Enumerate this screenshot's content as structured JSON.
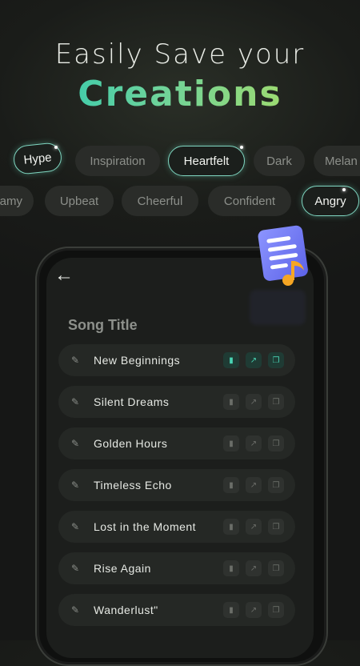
{
  "headline": {
    "line1": "Easily Save your",
    "line2": "Creations"
  },
  "moods": {
    "row1": [
      "Hype",
      "Inspiration",
      "Heartfelt",
      "Dark",
      "Melan"
    ],
    "row2": [
      "amy",
      "Upbeat",
      "Cheerful",
      "Confident",
      "Angry"
    ],
    "active": [
      "Hype",
      "Heartfelt",
      "Angry"
    ]
  },
  "phone": {
    "back_icon": "arrow-left-icon",
    "section_title": "Song Title",
    "songs": [
      {
        "title": "New Beginnings",
        "highlighted": true
      },
      {
        "title": "Silent Dreams",
        "highlighted": false
      },
      {
        "title": "Golden Hours",
        "highlighted": false
      },
      {
        "title": "Timeless Echo",
        "highlighted": false
      },
      {
        "title": "Lost in the Moment",
        "highlighted": false
      },
      {
        "title": "Rise Again",
        "highlighted": false
      },
      {
        "title": "Wanderlust\"",
        "highlighted": false
      }
    ],
    "row_actions": [
      "trash-icon",
      "share-icon",
      "copy-icon"
    ]
  },
  "colors": {
    "accent": "#49d3b3",
    "gradient_start": "#1fc7b6",
    "gradient_end": "#b9df58",
    "doc_icon": "#6e78ff",
    "note_icon": "#f6a623"
  }
}
